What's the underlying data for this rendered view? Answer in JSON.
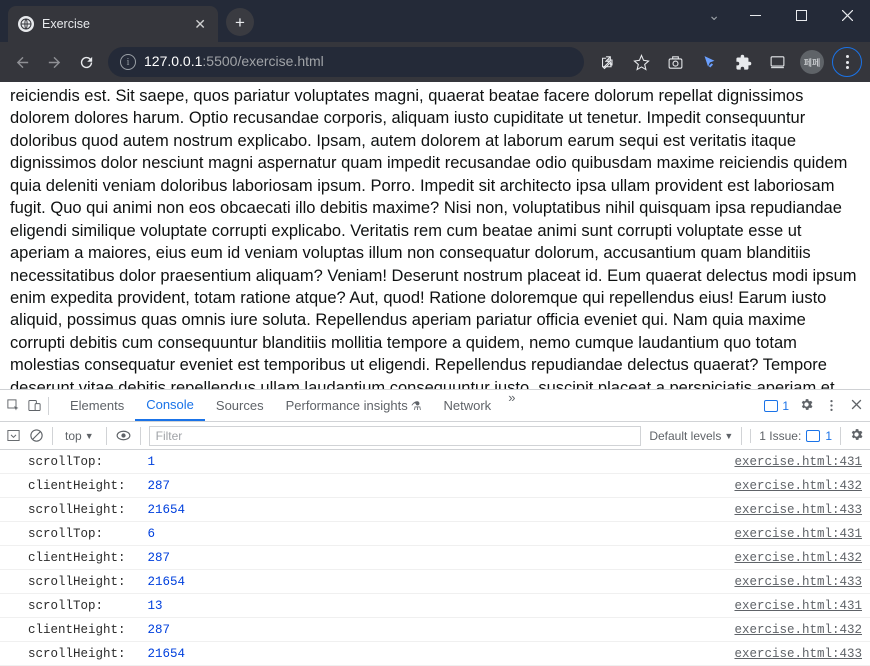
{
  "window": {
    "title": "Exercise"
  },
  "address": {
    "host": "127.0.0.1",
    "port": ":5500",
    "path": "/exercise.html"
  },
  "profile_label": "페페",
  "page_text": "reiciendis est. Sit saepe, quos pariatur voluptates magni, quaerat beatae facere dolorum repellat dignissimos dolorem dolores harum. Optio recusandae corporis, aliquam iusto cupiditate ut tenetur. Impedit consequuntur doloribus quod autem nostrum explicabo. Ipsam, autem dolorem at laborum earum sequi est veritatis itaque dignissimos dolor nesciunt magni aspernatur quam impedit recusandae odio quibusdam maxime reiciendis quidem quia deleniti veniam doloribus laboriosam ipsum. Porro. Impedit sit architecto ipsa ullam provident est laboriosam fugit. Quo qui animi non eos obcaecati illo debitis maxime? Nisi non, voluptatibus nihil quisquam ipsa repudiandae eligendi similique voluptate corrupti explicabo. Veritatis rem cum beatae animi sunt corrupti voluptate esse ut aperiam a maiores, eius eum id veniam voluptas illum non consequatur dolorum, accusantium quam blanditiis necessitatibus dolor praesentium aliquam? Veniam! Deserunt nostrum placeat id. Eum quaerat delectus modi ipsum enim expedita provident, totam ratione atque? Aut, quod! Ratione doloremque qui repellendus eius! Earum iusto aliquid, possimus quas omnis iure soluta. Repellendus aperiam pariatur officia eveniet qui. Nam quia maxime corrupti debitis cum consequuntur blanditiis mollitia tempore a quidem, nemo cumque laudantium quo totam molestias consequatur eveniet est temporibus ut eligendi. Repellendus repudiandae delectus quaerat? Tempore deserunt vitae debitis repellendus ullam laudantium consequuntur iusto, suscipit placeat a perspiciatis aperiam et",
  "devtools": {
    "tabs": [
      "Elements",
      "Console",
      "Sources",
      "Performance insights",
      "Network"
    ],
    "active_tab": "Console",
    "issues_count_top": "1",
    "context": "top",
    "filter_placeholder": "Filter",
    "levels_label": "Default levels",
    "issues_label": "1 Issue:",
    "issues_count": "1"
  },
  "console_rows": [
    {
      "label": "scrollTop:",
      "value": "1",
      "src": "exercise.html:431"
    },
    {
      "label": "clientHeight:",
      "value": "287",
      "src": "exercise.html:432"
    },
    {
      "label": "scrollHeight:",
      "value": "21654",
      "src": "exercise.html:433"
    },
    {
      "label": "scrollTop:",
      "value": "6",
      "src": "exercise.html:431"
    },
    {
      "label": "clientHeight:",
      "value": "287",
      "src": "exercise.html:432"
    },
    {
      "label": "scrollHeight:",
      "value": "21654",
      "src": "exercise.html:433"
    },
    {
      "label": "scrollTop:",
      "value": "13",
      "src": "exercise.html:431"
    },
    {
      "label": "clientHeight:",
      "value": "287",
      "src": "exercise.html:432"
    },
    {
      "label": "scrollHeight:",
      "value": "21654",
      "src": "exercise.html:433"
    }
  ]
}
